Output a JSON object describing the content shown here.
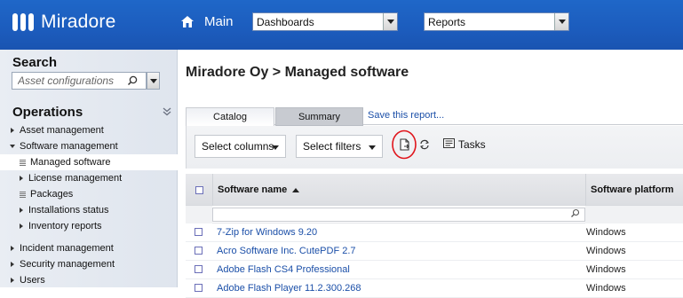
{
  "header": {
    "logo_text": "Miradore",
    "main_label": "Main",
    "dashboards_value": "Dashboards",
    "reports_value": "Reports"
  },
  "sidebar": {
    "search_title": "Search",
    "search_placeholder": "Asset configurations",
    "operations_title": "Operations",
    "items": [
      {
        "label": "Asset management"
      },
      {
        "label": "Software management"
      },
      {
        "label": "Managed software"
      },
      {
        "label": "License management"
      },
      {
        "label": "Packages"
      },
      {
        "label": "Installations status"
      },
      {
        "label": "Inventory reports"
      },
      {
        "label": "Incident management"
      },
      {
        "label": "Security management"
      },
      {
        "label": "Users"
      }
    ]
  },
  "main": {
    "breadcrumb": "Miradore Oy > Managed software",
    "tabs": [
      {
        "label": "Catalog"
      },
      {
        "label": "Summary"
      }
    ],
    "save_report_link": "Save this report...",
    "toolbar": {
      "select_columns": "Select columns",
      "select_filters": "Select filters",
      "tasks": "Tasks"
    },
    "table": {
      "columns": [
        "Software name",
        "Software platform"
      ],
      "rows": [
        {
          "name": "7-Zip for Windows 9.20",
          "platform": "Windows"
        },
        {
          "name": "Acro Software Inc. CutePDF 2.7",
          "platform": "Windows"
        },
        {
          "name": "Adobe Flash CS4 Professional",
          "platform": "Windows"
        },
        {
          "name": "Adobe Flash Player 11.2.300.268",
          "platform": "Windows"
        }
      ]
    }
  },
  "colors": {
    "topbar": "#1c5cbd",
    "link": "#1b4fa8",
    "annotation": "#e0141b"
  }
}
